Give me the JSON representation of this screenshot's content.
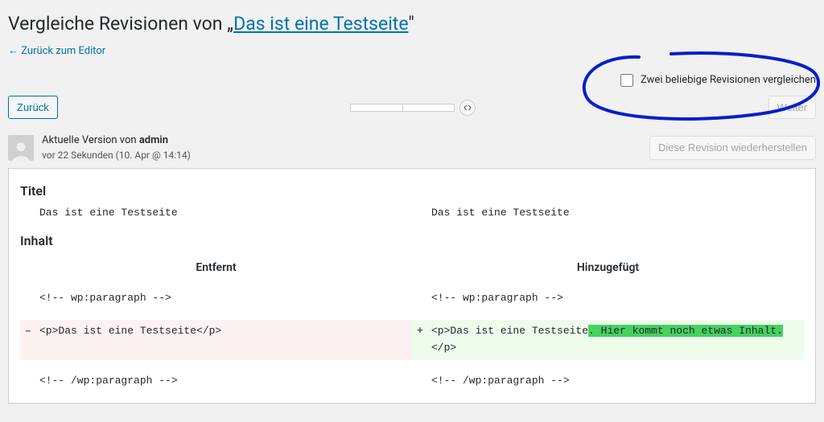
{
  "header": {
    "title_prefix": "Vergleiche Revisionen von „",
    "title_link": "Das ist eine Testseite",
    "title_suffix": "\"",
    "back_to_editor": "← Zurück zum Editor"
  },
  "compare": {
    "checkbox_label": "Zwei beliebige Revisionen vergleichen"
  },
  "nav": {
    "prev": "Zurück",
    "next": "Weiter"
  },
  "meta": {
    "current_version_prefix": "Aktuelle Version von ",
    "author": "admin",
    "time_ago": "vor 22 Sekunden (10. Apr @ 14:14)",
    "restore_button": "Diese Revision wiederherstellen"
  },
  "sections": {
    "title_label": "Titel",
    "content_label": "Inhalt",
    "removed_label": "Entfernt",
    "added_label": "Hinzugefügt"
  },
  "diff": {
    "title_left": "Das ist eine Testseite",
    "title_right": "Das ist eine Testseite",
    "rows": [
      {
        "left": "<!-- wp:paragraph -->",
        "right": "<!-- wp:paragraph -->",
        "type": "context"
      },
      {
        "left": "<p>Das ist eine Testseite</p>",
        "right_pre": "<p>Das ist eine Testseite",
        "right_ins": ". Hier kommt noch etwas Inhalt.",
        "right_post": "</p>",
        "type": "change"
      },
      {
        "left": "<!-- /wp:paragraph -->",
        "right": "<!-- /wp:paragraph -->",
        "type": "context"
      }
    ]
  }
}
